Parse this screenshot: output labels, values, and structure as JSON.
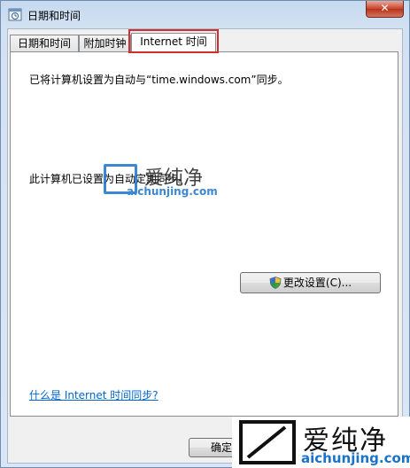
{
  "window": {
    "title": "日期和时间",
    "close_label": "✕"
  },
  "tabs": [
    {
      "label": "日期和时间"
    },
    {
      "label": "附加时钟"
    },
    {
      "label": "Internet 时间"
    }
  ],
  "panel": {
    "sync_message": "已将计算机设置为自动与“time.windows.com”同步。",
    "schedule_message": "此计算机已设置为自动定期同步。",
    "change_settings_label": "更改设置(C)...",
    "help_link": "什么是 Internet 时间同步?"
  },
  "footer": {
    "ok_label": "确定"
  },
  "watermark": {
    "cn": "爱纯净",
    "en": "aichunjing.com"
  },
  "colors": {
    "accent": "#1a73c8",
    "highlight": "#d12e2e",
    "link": "#0066cc"
  }
}
